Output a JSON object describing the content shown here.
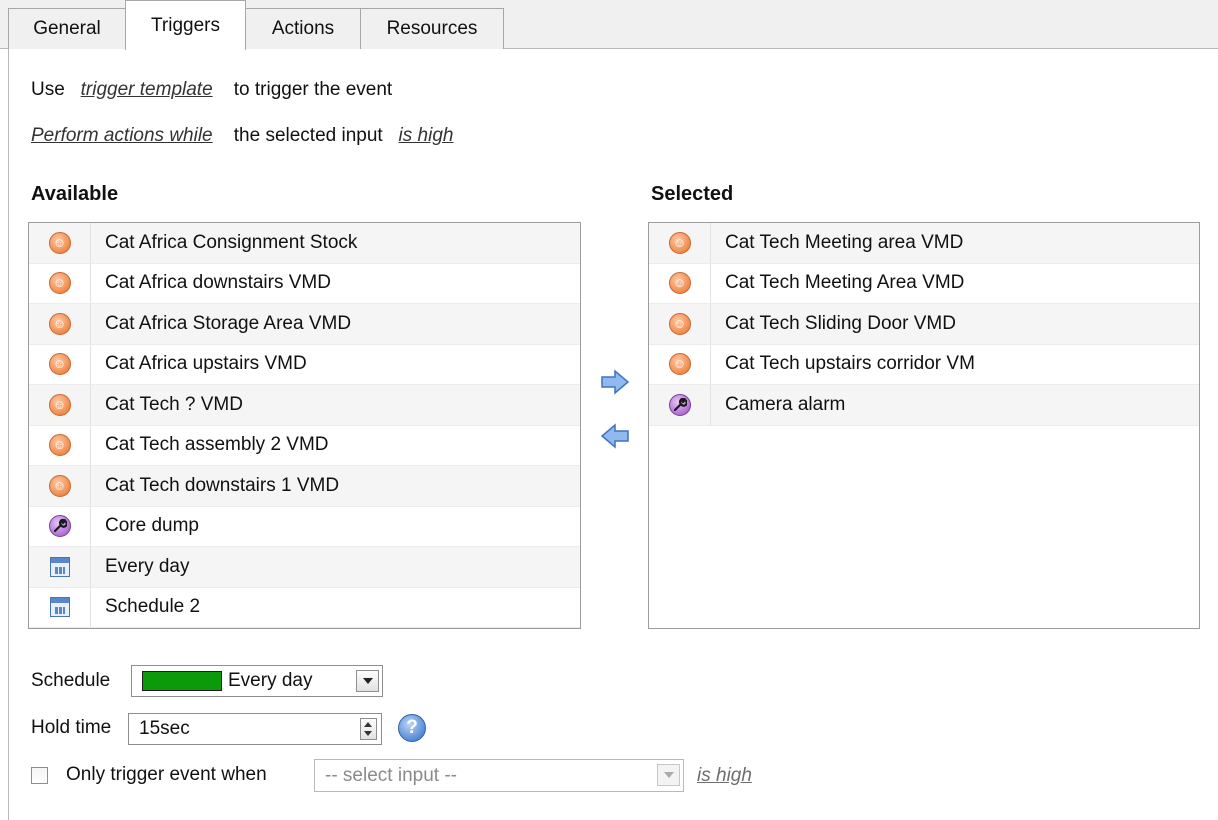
{
  "tabs": [
    {
      "label": "General",
      "active": false
    },
    {
      "label": "Triggers",
      "active": true
    },
    {
      "label": "Actions",
      "active": false
    },
    {
      "label": "Resources",
      "active": false
    }
  ],
  "trigger_line": {
    "prefix": "Use",
    "link": "trigger template",
    "suffix": "to trigger the event"
  },
  "perform_line": {
    "link": "Perform actions while",
    "middle": "the selected input",
    "state_link": "is high"
  },
  "available": {
    "heading": "Available",
    "items": [
      {
        "icon": "motion-detection-icon",
        "label": "Cat Africa Consignment Stock"
      },
      {
        "icon": "motion-detection-icon",
        "label": "Cat Africa downstairs VMD"
      },
      {
        "icon": "motion-detection-icon",
        "label": "Cat Africa Storage Area VMD"
      },
      {
        "icon": "motion-detection-icon",
        "label": "Cat Africa upstairs VMD"
      },
      {
        "icon": "motion-detection-icon",
        "label": "Cat Tech ? VMD"
      },
      {
        "icon": "motion-detection-icon",
        "label": "Cat Tech assembly 2 VMD"
      },
      {
        "icon": "motion-detection-icon",
        "label": "Cat Tech downstairs 1 VMD"
      },
      {
        "icon": "wrench-alarm-icon",
        "label": "Core dump"
      },
      {
        "icon": "calendar-icon",
        "label": "Every day"
      },
      {
        "icon": "calendar-icon",
        "label": "Schedule 2"
      }
    ]
  },
  "selected": {
    "heading": "Selected",
    "items": [
      {
        "icon": "motion-detection-icon",
        "label": "Cat Tech Meeting area VMD"
      },
      {
        "icon": "motion-detection-icon",
        "label": "Cat Tech Meeting Area VMD"
      },
      {
        "icon": "motion-detection-icon",
        "label": "Cat Tech Sliding Door VMD"
      },
      {
        "icon": "motion-detection-icon",
        "label": "Cat Tech upstairs corridor VM"
      },
      {
        "icon": "wrench-alarm-icon",
        "label": "Camera alarm"
      }
    ]
  },
  "schedule": {
    "label": "Schedule",
    "value": "Every day",
    "swatch_color": "#0a9a0a"
  },
  "hold_time": {
    "label": "Hold time",
    "value": "15sec"
  },
  "only_trigger": {
    "label": "Only trigger event when",
    "placeholder": "-- select input --",
    "state_link": "is high",
    "checked": false
  },
  "colors": {
    "motion": "#f08a4b",
    "alarm": "#b06fd3",
    "arrow": "#6fa3e6",
    "calendar": "#4a74b8"
  }
}
